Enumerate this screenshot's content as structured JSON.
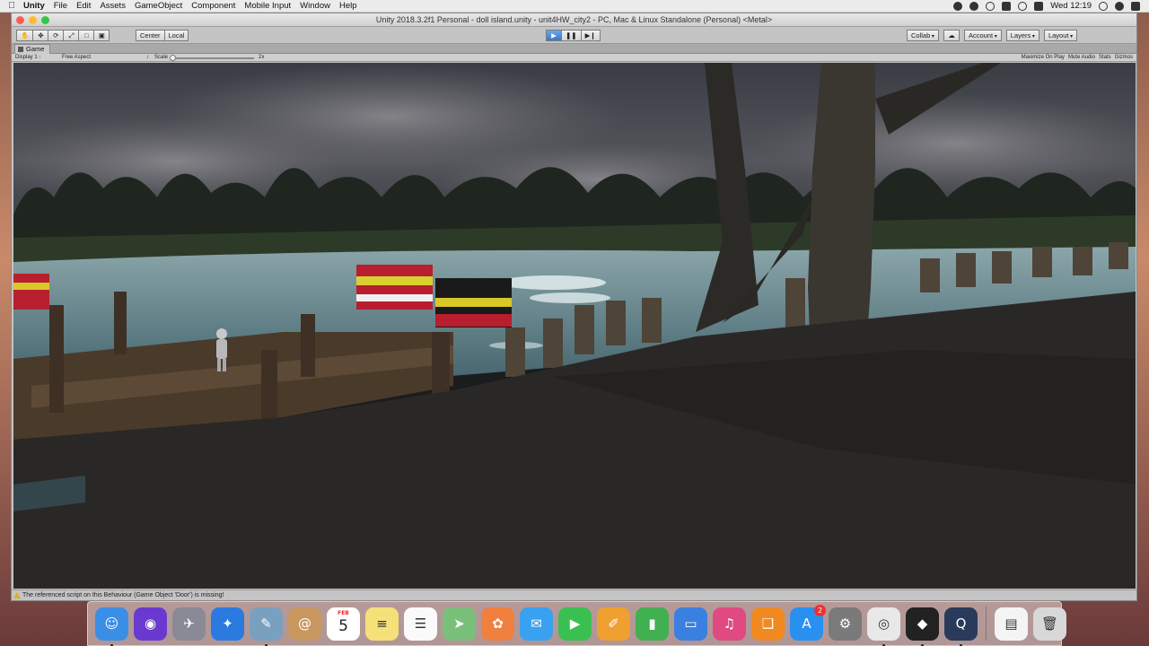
{
  "menubar": {
    "app": "Unity",
    "items": [
      "File",
      "Edit",
      "Assets",
      "GameObject",
      "Component",
      "Mobile Input",
      "Window",
      "Help"
    ],
    "clock": "Wed 12:19"
  },
  "window": {
    "title": "Unity 2018.3.2f1 Personal - doll island.unity - unit4HW_city2 - PC, Mac & Linux Standalone (Personal) <Metal>"
  },
  "toolbar": {
    "pivot_label": "Center",
    "space_label": "Local",
    "collab_label": "Collab",
    "account_label": "Account",
    "layers_label": "Layers",
    "layout_label": "Layout"
  },
  "game_view": {
    "tab_label": "Game",
    "display_label": "Display 1",
    "aspect_label": "Free Aspect",
    "scale_label": "Scale",
    "scale_value": "2x",
    "maximize_label": "Maximize On Play",
    "mute_label": "Mute Audio",
    "stats_label": "Stats",
    "gizmos_label": "Gizmos"
  },
  "status": {
    "message": "The referenced script on this Behaviour (Game Object 'Door') is missing!"
  },
  "dock": {
    "calendar_month": "FEB",
    "calendar_day": "5",
    "appstore_badge": "2",
    "items": [
      {
        "name": "finder-icon",
        "color": "#3a8ee6",
        "glyph": "☺"
      },
      {
        "name": "siri-icon",
        "color": "#6a3ad0",
        "glyph": "◉"
      },
      {
        "name": "launchpad-icon",
        "color": "#8a8a96",
        "glyph": "✈"
      },
      {
        "name": "safari-icon",
        "color": "#2a7ae0",
        "glyph": "✦"
      },
      {
        "name": "preview-icon",
        "color": "#7aa0c0",
        "glyph": "✎"
      },
      {
        "name": "contacts-icon",
        "color": "#c89860",
        "glyph": "@"
      },
      {
        "name": "calendar-icon",
        "color": "#ffffff",
        "glyph": ""
      },
      {
        "name": "notes-icon",
        "color": "#f6e07a",
        "glyph": "≡"
      },
      {
        "name": "reminders-icon",
        "color": "#fafafa",
        "glyph": "☰"
      },
      {
        "name": "maps-icon",
        "color": "#7ac07a",
        "glyph": "➤"
      },
      {
        "name": "photos-icon",
        "color": "#f08040",
        "glyph": "✿"
      },
      {
        "name": "messages-icon",
        "color": "#3aa0f0",
        "glyph": "✉"
      },
      {
        "name": "facetime-icon",
        "color": "#3ac050",
        "glyph": "▶"
      },
      {
        "name": "pages-icon",
        "color": "#f0a030",
        "glyph": "✐"
      },
      {
        "name": "numbers-icon",
        "color": "#40b050",
        "glyph": "▮"
      },
      {
        "name": "keynote-icon",
        "color": "#3a80e0",
        "glyph": "▭"
      },
      {
        "name": "itunes-icon",
        "color": "#e04a80",
        "glyph": "♫"
      },
      {
        "name": "books-icon",
        "color": "#f08a20",
        "glyph": "❑"
      },
      {
        "name": "appstore-icon",
        "color": "#2a90f0",
        "glyph": "A"
      },
      {
        "name": "system-preferences-icon",
        "color": "#7a7a7a",
        "glyph": "⚙"
      },
      {
        "name": "chrome-icon",
        "color": "#e8e8e8",
        "glyph": "◎"
      },
      {
        "name": "unity-icon",
        "color": "#222222",
        "glyph": "◆"
      },
      {
        "name": "quicktime-icon",
        "color": "#2a3a5a",
        "glyph": "Q"
      },
      {
        "name": "jpeg-file-icon",
        "color": "#f4f4f4",
        "glyph": "▤"
      },
      {
        "name": "trash-icon",
        "color": "#d8d8d8",
        "glyph": "🗑"
      }
    ]
  }
}
